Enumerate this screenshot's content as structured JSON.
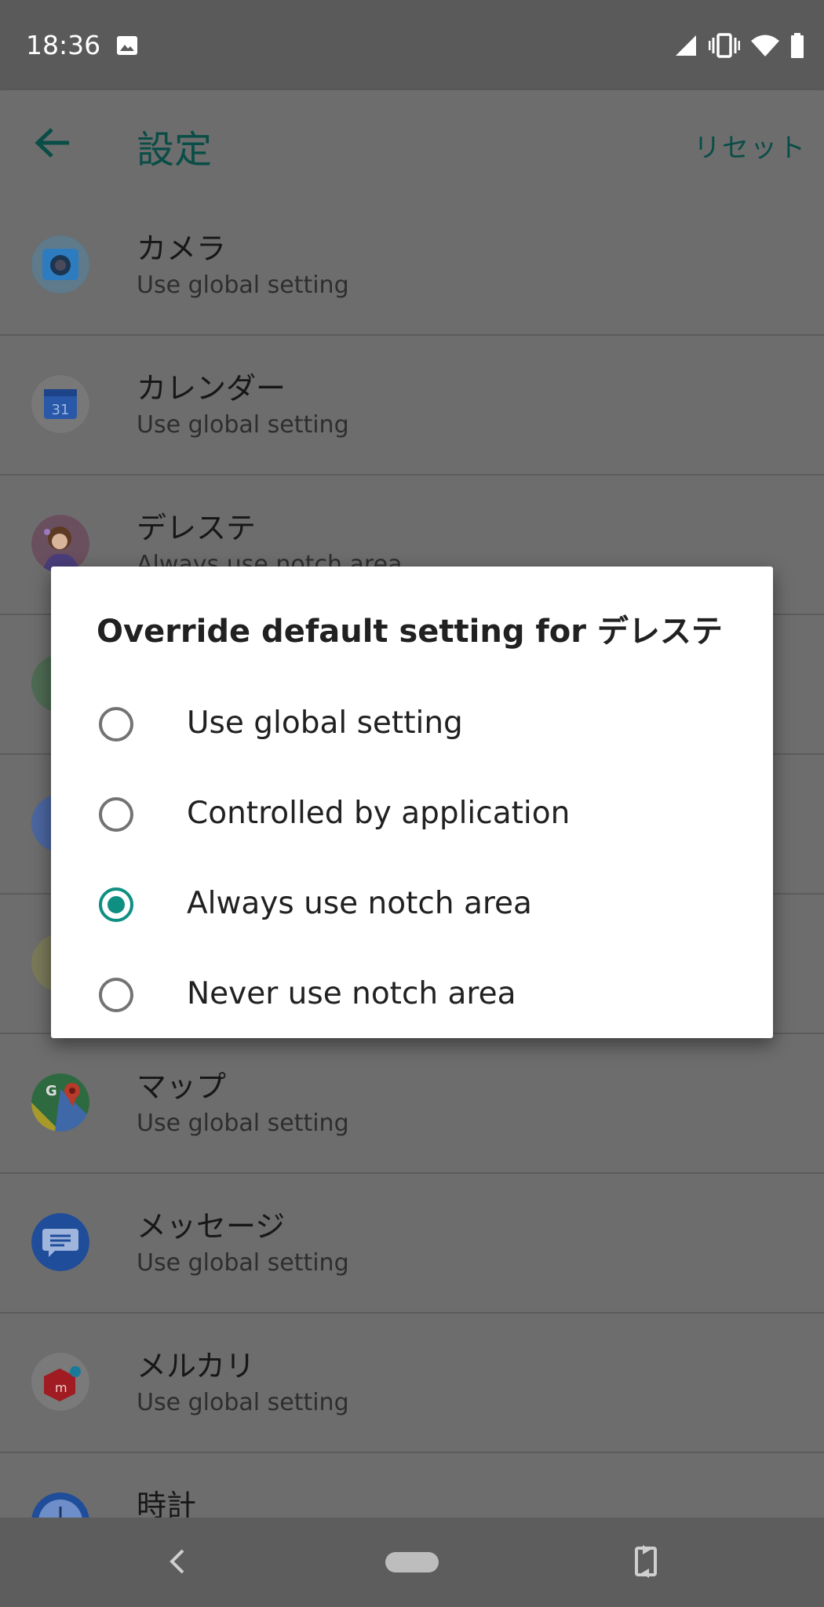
{
  "status_bar": {
    "time": "18:36"
  },
  "app_bar": {
    "title": "設定",
    "reset_label": "リセット"
  },
  "list": [
    {
      "title": "カメラ",
      "subtitle": "Use global setting",
      "icon": "camera-app-icon"
    },
    {
      "title": "カレンダー",
      "subtitle": "Use global setting",
      "icon": "calendar-app-icon",
      "icon_text": "31"
    },
    {
      "title": "デレステ",
      "subtitle": "Always use notch area",
      "icon": "deresute-app-icon"
    },
    {
      "title": "",
      "subtitle": "",
      "icon": "hidden-app-icon"
    },
    {
      "title": "",
      "subtitle": "",
      "icon": "hidden-app-icon"
    },
    {
      "title": "",
      "subtitle": "",
      "icon": "hidden-app-icon"
    },
    {
      "title": "マップ",
      "subtitle": "Use global setting",
      "icon": "maps-app-icon",
      "icon_text": "G"
    },
    {
      "title": "メッセージ",
      "subtitle": "Use global setting",
      "icon": "messages-app-icon"
    },
    {
      "title": "メルカリ",
      "subtitle": "Use global setting",
      "icon": "mercari-app-icon",
      "icon_text": "m"
    },
    {
      "title": "時計",
      "subtitle": "",
      "icon": "clock-app-icon"
    }
  ],
  "dialog": {
    "title": "Override default setting for デレステ",
    "options": [
      {
        "label": "Use global setting",
        "checked": false
      },
      {
        "label": "Controlled by application",
        "checked": false
      },
      {
        "label": "Always use notch area",
        "checked": true
      },
      {
        "label": "Never use notch area",
        "checked": false
      }
    ]
  },
  "colors": {
    "accent": "#0e8f82",
    "scrim_background": "#6d6d6d",
    "title_teal": "#0a4d47"
  }
}
